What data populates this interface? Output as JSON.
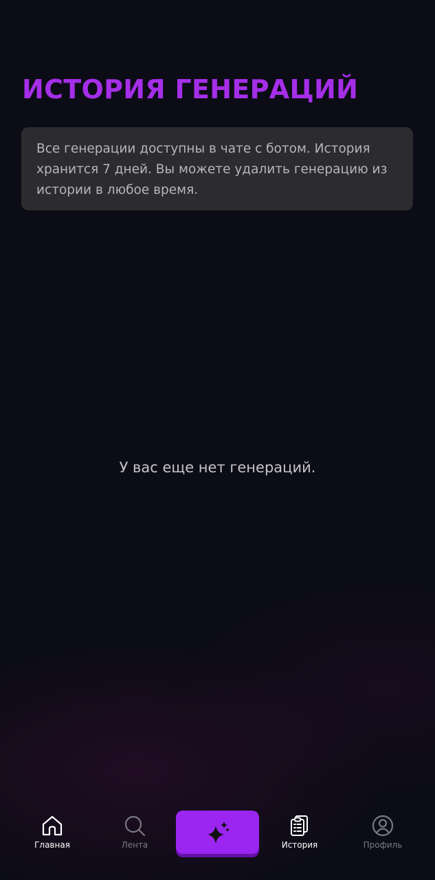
{
  "header": {
    "title": "ИСТОРИЯ ГЕНЕРАЦИЙ"
  },
  "info_card": {
    "text": "Все генерации доступны в чате с ботом. История хранится 7 дней. Вы можете удалить генерацию из истории в любое время."
  },
  "empty_state": {
    "text": "У вас еще нет генераций."
  },
  "bottom_nav": {
    "items": [
      {
        "label": "Главная",
        "icon": "home-icon",
        "active": true
      },
      {
        "label": "Лента",
        "icon": "search-icon",
        "active": false
      },
      {
        "label": "",
        "icon": "sparkles-icon",
        "active": false
      },
      {
        "label": "История",
        "icon": "clipboard-list-icon",
        "active": true
      },
      {
        "label": "Профиль",
        "icon": "user-circle-icon",
        "active": false
      }
    ]
  },
  "colors": {
    "background": "#0c0c16",
    "accent": "#a52ee8",
    "card": "#2b2b30",
    "button": "#9b25f1",
    "button_shadow": "#6612a8",
    "nav_active": "#ffffff",
    "nav_inactive": "#7a7a82"
  }
}
